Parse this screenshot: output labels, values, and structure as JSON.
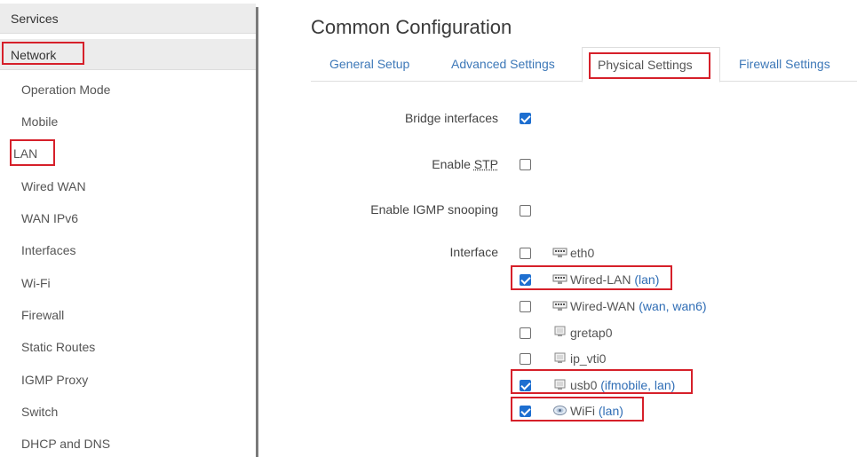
{
  "sidebar": {
    "services_label": "Services",
    "network_label": "Network",
    "items": [
      {
        "label": "Operation Mode"
      },
      {
        "label": "Mobile"
      },
      {
        "label": "LAN"
      },
      {
        "label": "Wired WAN"
      },
      {
        "label": "WAN IPv6"
      },
      {
        "label": "Interfaces"
      },
      {
        "label": "Wi-Fi"
      },
      {
        "label": "Firewall"
      },
      {
        "label": "Static Routes"
      },
      {
        "label": "IGMP Proxy"
      },
      {
        "label": "Switch"
      },
      {
        "label": "DHCP and DNS"
      }
    ]
  },
  "main": {
    "title": "Common Configuration",
    "tabs": [
      {
        "label": "General Setup"
      },
      {
        "label": "Advanced Settings"
      },
      {
        "label": "Physical Settings",
        "active": true
      },
      {
        "label": "Firewall Settings"
      }
    ],
    "form": {
      "bridge_label": "Bridge interfaces",
      "bridge_checked": true,
      "stp_label_prefix": "Enable ",
      "stp_label_abbr": "STP",
      "stp_checked": false,
      "igmp_label": "Enable IGMP snooping",
      "igmp_checked": false,
      "interface_label": "Interface",
      "interfaces": [
        {
          "name": "eth0",
          "zones": "",
          "checked": false,
          "icon": "ethernet-icon"
        },
        {
          "name": "Wired-LAN",
          "zones": "(lan)",
          "checked": true,
          "icon": "ethernet-icon"
        },
        {
          "name": "Wired-WAN",
          "zones": "(wan, wan6)",
          "checked": false,
          "icon": "ethernet-icon"
        },
        {
          "name": "gretap0",
          "zones": "",
          "checked": false,
          "icon": "tunnel-icon"
        },
        {
          "name": "ip_vti0",
          "zones": "",
          "checked": false,
          "icon": "tunnel-icon"
        },
        {
          "name": "usb0",
          "zones": "(ifmobile, lan)",
          "checked": true,
          "icon": "tunnel-icon"
        },
        {
          "name": "WiFi",
          "zones": "(lan)",
          "checked": true,
          "icon": "wifi-icon"
        }
      ]
    }
  },
  "colors": {
    "accent_link": "#3d78b8",
    "checkbox_on": "#1e6fd0",
    "highlight_red": "#d6202a"
  }
}
